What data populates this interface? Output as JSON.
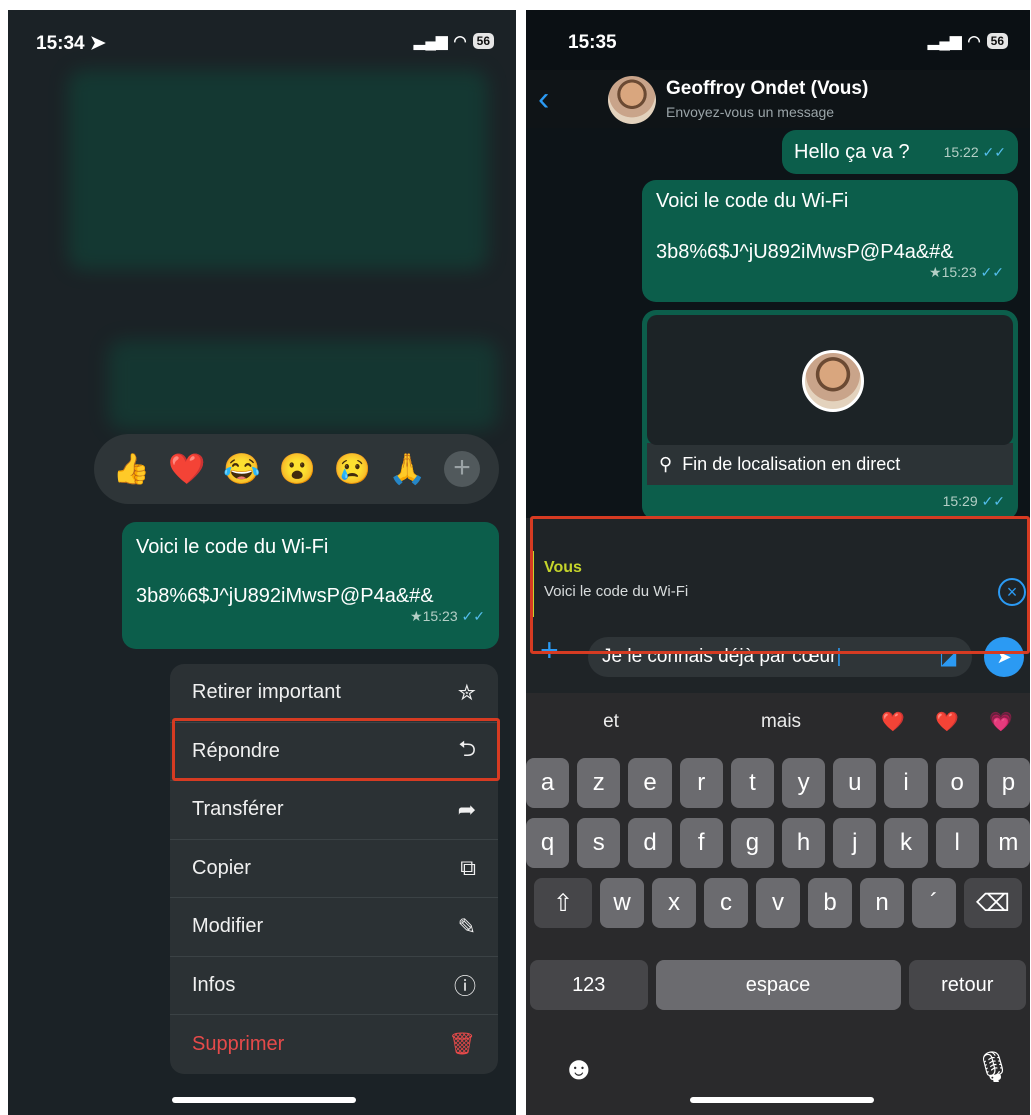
{
  "left_screen": {
    "status": {
      "time": "15:34",
      "battery": "56"
    },
    "reactions": [
      "👍",
      "❤️",
      "😂",
      "😮",
      "😢",
      "🙏"
    ],
    "message": {
      "line1": "Voici le code du Wi-Fi",
      "line2": "3b8%6$J^jU892iMwsP@P4a&#&",
      "time": "★15:23"
    },
    "menu": [
      {
        "label": "Retirer important",
        "icon": "unstar-icon"
      },
      {
        "label": "Répondre",
        "icon": "reply-icon"
      },
      {
        "label": "Transférer",
        "icon": "forward-icon"
      },
      {
        "label": "Copier",
        "icon": "copy-icon"
      },
      {
        "label": "Modifier",
        "icon": "pencil-icon"
      },
      {
        "label": "Infos",
        "icon": "info-icon"
      },
      {
        "label": "Supprimer",
        "icon": "trash-icon"
      }
    ]
  },
  "right_screen": {
    "status": {
      "time": "15:35",
      "battery": "56"
    },
    "header": {
      "name": "Geoffroy Ondet (Vous)",
      "subtitle": "Envoyez-vous un message"
    },
    "messages": {
      "m1": {
        "text": "Hello ça va ?",
        "time": "15:22"
      },
      "m2": {
        "line1": "Voici le code du Wi-Fi",
        "line2": "3b8%6$J^jU892iMwsP@P4a&#&",
        "time": "★15:23"
      },
      "m3": {
        "text": "Fin de localisation en direct",
        "time": "15:29"
      }
    },
    "reply": {
      "author": "Vous",
      "text": "Voici le code du Wi-Fi"
    },
    "input": {
      "value": "Je le connais déjà par cœur"
    },
    "suggestions": [
      "et",
      "mais",
      "❤️",
      "❤️",
      "💗"
    ],
    "keyboard": {
      "row1": [
        "a",
        "z",
        "e",
        "r",
        "t",
        "y",
        "u",
        "i",
        "o",
        "p"
      ],
      "row2": [
        "q",
        "s",
        "d",
        "f",
        "g",
        "h",
        "j",
        "k",
        "l",
        "m"
      ],
      "row3": [
        "w",
        "x",
        "c",
        "v",
        "b",
        "n",
        "´"
      ],
      "numbers_key": "123",
      "space_key": "espace",
      "return_key": "retour"
    }
  }
}
